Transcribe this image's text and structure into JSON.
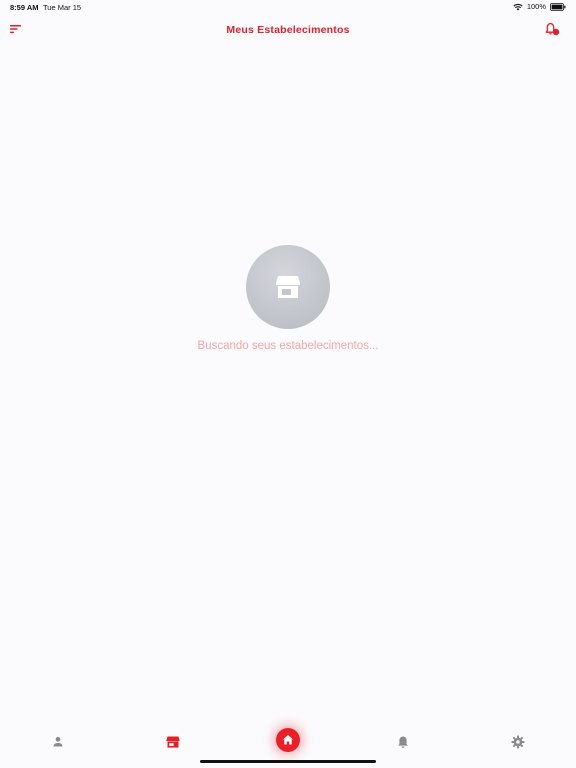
{
  "status_bar": {
    "time": "8:59 AM",
    "date": "Tue Mar 15",
    "battery": "100%"
  },
  "header": {
    "title": "Meus Estabelecimentos",
    "menu_icon": "sort-menu-icon",
    "bell_icon": "bell-with-badge-icon"
  },
  "main": {
    "loading_icon": "store-icon",
    "loading_text": "Buscando seus estabelecimentos..."
  },
  "bottom_nav": {
    "items": [
      {
        "icon": "person-icon",
        "active": false
      },
      {
        "icon": "store-icon",
        "active": true
      },
      {
        "icon": "home-icon",
        "active": true
      },
      {
        "icon": "bell-icon",
        "active": false
      },
      {
        "icon": "gear-icon",
        "active": false
      }
    ]
  },
  "colors": {
    "accent": "#e0202b",
    "background": "#fbfafc",
    "muted_icon": "#8a8a92",
    "loading_text": "#f0a6a9",
    "loading_circle": "#c4c6cd"
  }
}
